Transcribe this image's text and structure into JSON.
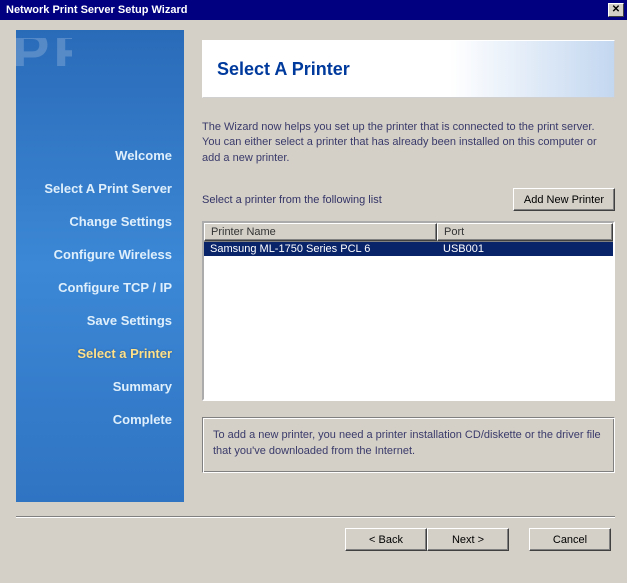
{
  "window": {
    "title": "Network Print Server Setup Wizard"
  },
  "sidebar": {
    "watermark": "PRIN",
    "items": [
      {
        "label": "Welcome",
        "active": false
      },
      {
        "label": "Select A Print Server",
        "active": false
      },
      {
        "label": "Change Settings",
        "active": false
      },
      {
        "label": "Configure Wireless",
        "active": false
      },
      {
        "label": "Configure TCP / IP",
        "active": false
      },
      {
        "label": "Save Settings",
        "active": false
      },
      {
        "label": "Select a Printer",
        "active": true
      },
      {
        "label": "Summary",
        "active": false
      },
      {
        "label": "Complete",
        "active": false
      }
    ]
  },
  "main": {
    "heading": "Select A Printer",
    "description": "The Wizard now helps you set up the printer that is connected to the print server. You can either select a printer that has already been installed on this computer or add a new printer.",
    "list_label": "Select a printer from the following list",
    "add_button": "Add New Printer",
    "columns": {
      "name": "Printer Name",
      "port": "Port"
    },
    "printers": [
      {
        "name": "Samsung ML-1750 Series PCL 6",
        "port": "USB001",
        "selected": true
      }
    ],
    "hint": "To add a new printer, you need a printer installation CD/diskette or the driver file that you've downloaded from the Internet."
  },
  "footer": {
    "back": "< Back",
    "next": "Next >",
    "cancel": "Cancel"
  }
}
